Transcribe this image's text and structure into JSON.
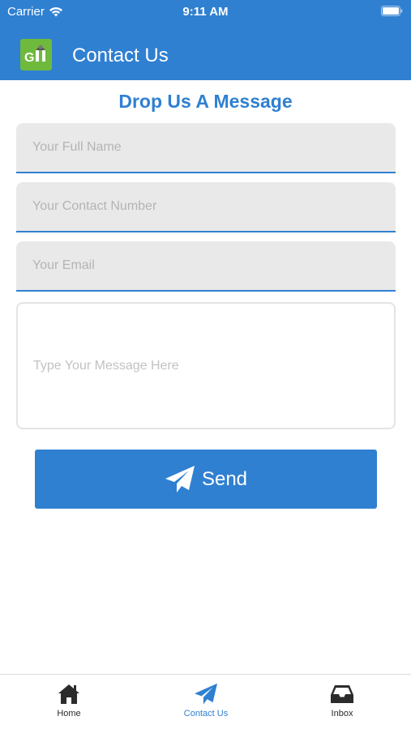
{
  "colors": {
    "primary": "#2f80d1",
    "field_bg": "#e9e9e9",
    "logo_bg": "#6fb93c",
    "tab_inactive": "#2b2b2b"
  },
  "status_bar": {
    "carrier": "Carrier",
    "time": "9:11 AM",
    "icons": [
      "wifi-icon",
      "battery-icon"
    ]
  },
  "nav": {
    "logo_text": "GM",
    "title": "Contact Us"
  },
  "form": {
    "heading": "Drop Us A Message",
    "name_placeholder": "Your Full Name",
    "phone_placeholder": "Your Contact Number",
    "email_placeholder": "Your Email",
    "message_placeholder": "Type Your Message Here",
    "send_label": "Send",
    "send_icon": "paper-plane-icon"
  },
  "tabs": [
    {
      "label": "Home",
      "icon": "home-icon",
      "active": false
    },
    {
      "label": "Contact Us",
      "icon": "paper-plane-icon",
      "active": true
    },
    {
      "label": "Inbox",
      "icon": "inbox-icon",
      "active": false
    }
  ]
}
